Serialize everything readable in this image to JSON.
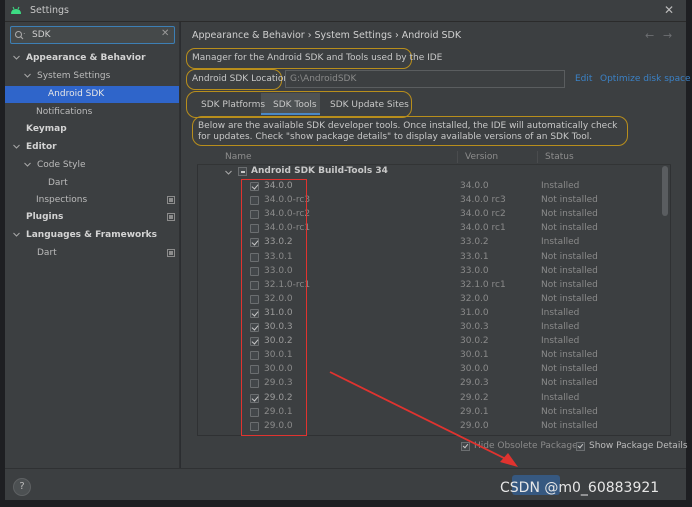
{
  "window": {
    "title": "Settings"
  },
  "search": {
    "value": "SDK"
  },
  "sidebar": {
    "items": [
      {
        "label": "Appearance & Behavior",
        "bold": true,
        "expanded": true
      },
      {
        "label": "System Settings",
        "bold": false,
        "expanded": true
      },
      {
        "label": "Android SDK",
        "bold": false,
        "selected": true
      },
      {
        "label": "Notifications",
        "bold": false
      },
      {
        "label": "Keymap",
        "bold": true
      },
      {
        "label": "Editor",
        "bold": true,
        "expanded": true
      },
      {
        "label": "Code Style",
        "bold": false,
        "expanded": true
      },
      {
        "label": "Dart",
        "bold": false
      },
      {
        "label": "Inspections",
        "bold": false
      },
      {
        "label": "Plugins",
        "bold": true
      },
      {
        "label": "Languages & Frameworks",
        "bold": true,
        "expanded": true
      },
      {
        "label": "Dart",
        "bold": false
      }
    ]
  },
  "breadcrumb": {
    "text": "Appearance & Behavior  ›  System Settings  ›  Android SDK"
  },
  "main": {
    "description": "Manager for the Android SDK and Tools used by the IDE",
    "location_label": "Android SDK Location:",
    "location_value": "G:\\AndroidSDK",
    "edit_link": "Edit",
    "optimize_link": "Optimize disk space",
    "tabs": [
      {
        "label": "SDK Platforms"
      },
      {
        "label": "SDK Tools",
        "active": true
      },
      {
        "label": "SDK Update Sites"
      }
    ],
    "info_text": "Below are the available SDK developer tools. Once installed, the IDE will automatically check for updates. Check \"show package details\" to display available versions of an SDK Tool."
  },
  "table": {
    "headers": {
      "name": "Name",
      "version": "Version",
      "status": "Status"
    },
    "group": "Android SDK Build-Tools 34",
    "rows": [
      {
        "name": "34.0.0",
        "version": "34.0.0",
        "status": "Installed",
        "checked": true
      },
      {
        "name": "34.0.0-rc3",
        "version": "34.0.0 rc3",
        "status": "Not installed",
        "checked": false
      },
      {
        "name": "34.0.0-rc2",
        "version": "34.0.0 rc2",
        "status": "Not installed",
        "checked": false
      },
      {
        "name": "34.0.0-rc1",
        "version": "34.0.0 rc1",
        "status": "Not installed",
        "checked": false
      },
      {
        "name": "33.0.2",
        "version": "33.0.2",
        "status": "Installed",
        "checked": true
      },
      {
        "name": "33.0.1",
        "version": "33.0.1",
        "status": "Not installed",
        "checked": false
      },
      {
        "name": "33.0.0",
        "version": "33.0.0",
        "status": "Not installed",
        "checked": false
      },
      {
        "name": "32.1.0-rc1",
        "version": "32.1.0 rc1",
        "status": "Not installed",
        "checked": false
      },
      {
        "name": "32.0.0",
        "version": "32.0.0",
        "status": "Not installed",
        "checked": false
      },
      {
        "name": "31.0.0",
        "version": "31.0.0",
        "status": "Installed",
        "checked": true
      },
      {
        "name": "30.0.3",
        "version": "30.0.3",
        "status": "Installed",
        "checked": true
      },
      {
        "name": "30.0.2",
        "version": "30.0.2",
        "status": "Installed",
        "checked": true
      },
      {
        "name": "30.0.1",
        "version": "30.0.1",
        "status": "Not installed",
        "checked": false
      },
      {
        "name": "30.0.0",
        "version": "30.0.0",
        "status": "Not installed",
        "checked": false
      },
      {
        "name": "29.0.3",
        "version": "29.0.3",
        "status": "Not installed",
        "checked": false
      },
      {
        "name": "29.0.2",
        "version": "29.0.2",
        "status": "Installed",
        "checked": true
      },
      {
        "name": "29.0.1",
        "version": "29.0.1",
        "status": "Not installed",
        "checked": false
      },
      {
        "name": "29.0.0",
        "version": "29.0.0",
        "status": "Not installed",
        "checked": false
      }
    ]
  },
  "options": {
    "hide_obsolete": {
      "label": "Hide Obsolete Packages",
      "checked": true
    },
    "show_details": {
      "label": "Show Package Details",
      "checked": true
    }
  },
  "footer": {
    "help": "?"
  },
  "watermark": "CSDN @m0_60883921",
  "colors": {
    "accent": "#2f65ca",
    "link": "#3b81c5",
    "highlight_outline": "#b88e1c",
    "annotation_red": "#e0332f"
  }
}
